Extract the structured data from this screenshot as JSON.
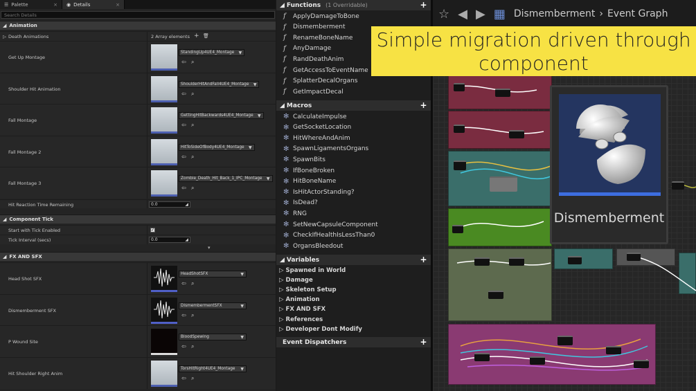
{
  "details": {
    "tabs": [
      {
        "label": "Palette"
      },
      {
        "label": "Details"
      }
    ],
    "search_placeholder": "Search Details",
    "cat_animation": "Animation",
    "death_animations": "Death Animations",
    "array_count": "2 Array elements",
    "anim_rows": [
      {
        "label": "Get Up Montage",
        "asset": "StandingUp4UE4_Montage"
      },
      {
        "label": "Shoulder Hit Animation",
        "asset": "ShoulderHitAndFall4UE4_Montage"
      },
      {
        "label": "Fall Montage",
        "asset": "GettingHitBackwards4UE4_Montage"
      },
      {
        "label": "Fall Montage 2",
        "asset": "HitToSideOfBody4UE4_Montage"
      },
      {
        "label": "Fall Montage 3",
        "asset": "Zombie_Death_Hit_Back_1_IPC_Montage"
      }
    ],
    "hit_reaction_label": "Hit Reaction Time Remaining",
    "hit_reaction_value": "0.0",
    "cat_tick": "Component Tick",
    "tick_enabled_label": "Start with Tick Enabled",
    "tick_interval_label": "Tick Interval (secs)",
    "tick_interval_value": "0.0",
    "cat_fx": "FX AND SFX",
    "fx_rows": [
      {
        "label": "Head Shot SFX",
        "asset": "HeadShotSFX"
      },
      {
        "label": "Dismemberment SFX",
        "asset": "DismembermentSFX"
      },
      {
        "label": "P Wound Site",
        "asset": "BloodSpewing"
      },
      {
        "label": "Hit Shoulder Right Anim",
        "asset": "TorsHitRight4UE4_Montage"
      }
    ]
  },
  "mybp": {
    "functions_label": "Functions",
    "functions_sub": "(1 Overridable)",
    "functions": [
      "ApplyDamageToBone",
      "Dismemberment",
      "RenameBoneName",
      "AnyDamage",
      "RandDeathAnim",
      "GetAccessToEventName",
      "SplatterDecalOrgans",
      "GetImpactDecal"
    ],
    "macros_label": "Macros",
    "macros": [
      "CalculateImpulse",
      "GetSocketLocation",
      "HitWhereAndAnim",
      "SpawnLigamentsOrgans",
      "SpawnBits",
      "IfBoneBroken",
      "HitBoneName",
      "IsHitActorStanding?",
      "IsDead?",
      "RNG",
      "SetNewCapsuleComponent",
      "CheckIfHealthIsLessThan0",
      "OrgansBleedout"
    ],
    "variables_label": "Variables",
    "variables": [
      "Spawned in World",
      "Damage",
      "Skeleton Setup",
      "Animation",
      "FX AND SFX",
      "References",
      "Developer Dont Modify"
    ],
    "dispatchers_label": "Event Dispatchers"
  },
  "graph": {
    "crumb1": "Dismemberment",
    "crumb_sep": "›",
    "crumb2": "Event Graph"
  },
  "banner": {
    "line1": "Simple migration driven through",
    "line2": "component"
  },
  "card": {
    "name": "Dismemberment"
  },
  "colors": {
    "banner": "#f7e244",
    "card_bg": "#243560"
  }
}
